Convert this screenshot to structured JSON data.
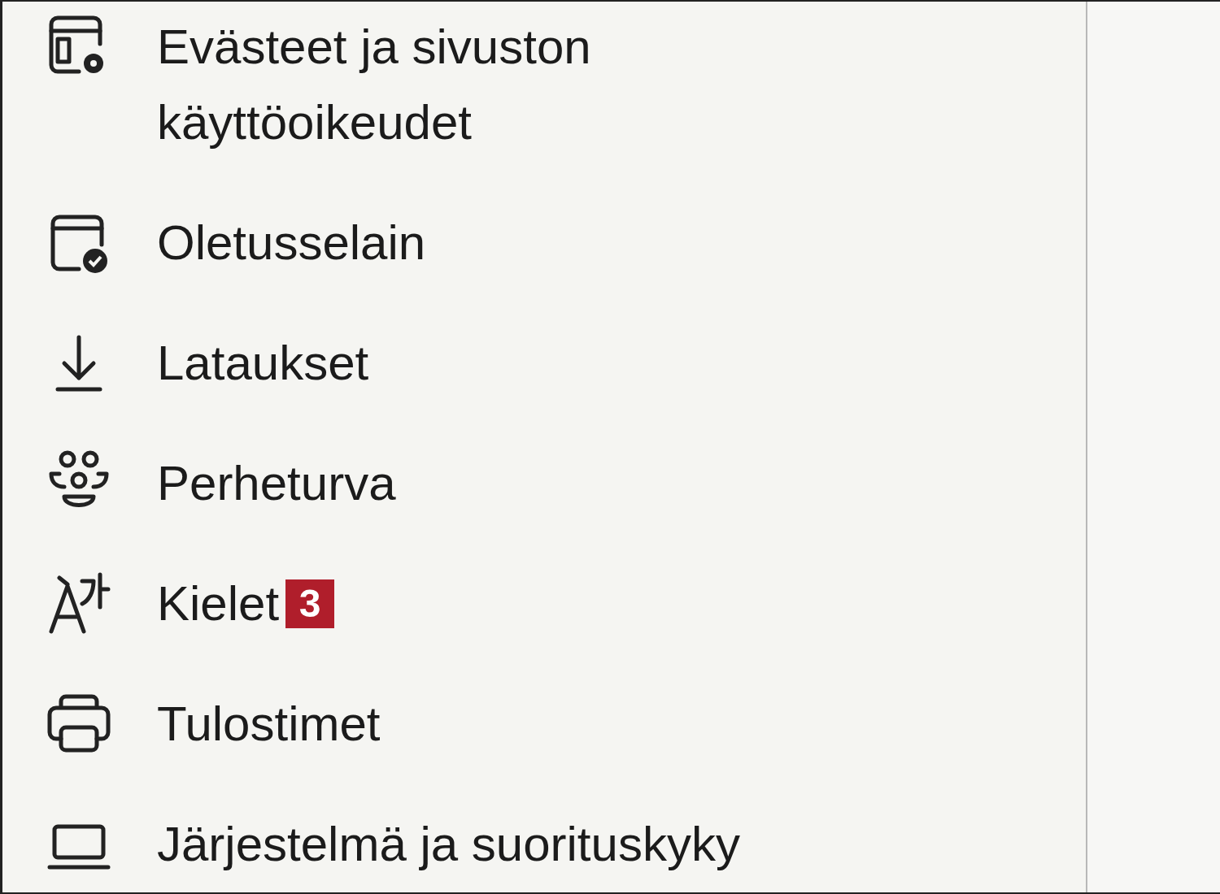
{
  "menu": {
    "items": [
      {
        "label": "Evästeet ja sivuston käyttöoikeudet"
      },
      {
        "label": "Oletusselain"
      },
      {
        "label": "Lataukset"
      },
      {
        "label": "Perheturva"
      },
      {
        "label": "Kielet",
        "badge": "3"
      },
      {
        "label": "Tulostimet"
      },
      {
        "label": "Järjestelmä ja suorituskyky"
      }
    ]
  }
}
